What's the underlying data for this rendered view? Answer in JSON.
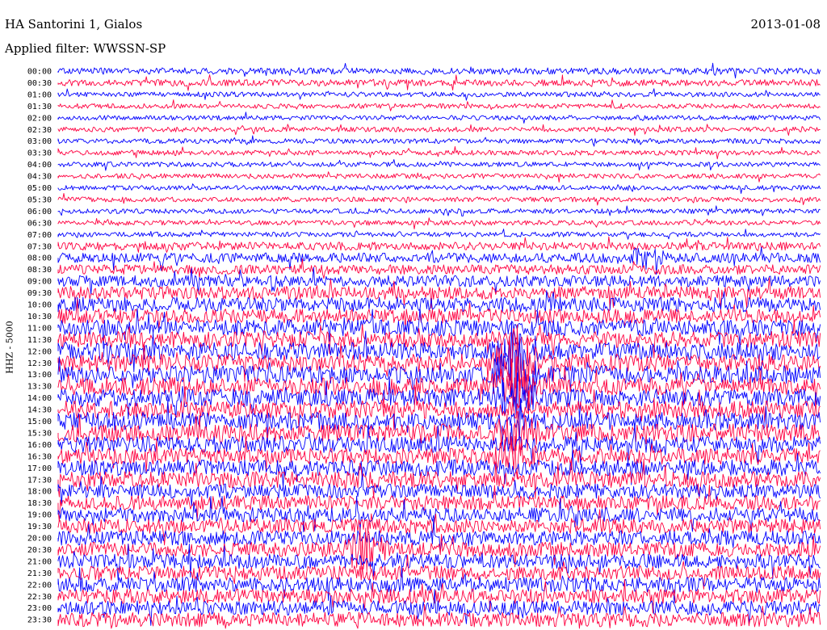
{
  "header": {
    "station": "HA Santorini 1, Gialos",
    "filter": "Applied filter: WWSSN-SP",
    "date": "2013-01-08"
  },
  "chart_data": {
    "type": "line",
    "title": "HA Santorini 1, Gialos",
    "subtitle": "Applied filter: WWSSN-SP",
    "date": "2013-01-08",
    "ylabel": "HHZ - 5000",
    "grid": false,
    "ytick_labels": [
      "00:00",
      "00:30",
      "01:00",
      "01:30",
      "02:00",
      "02:30",
      "03:00",
      "03:30",
      "04:00",
      "04:30",
      "05:00",
      "05:30",
      "06:00",
      "06:30",
      "07:00",
      "07:30",
      "08:00",
      "08:30",
      "09:00",
      "09:30",
      "10:00",
      "10:30",
      "11:00",
      "11:30",
      "12:00",
      "12:30",
      "13:00",
      "13:30",
      "14:00",
      "14:30",
      "15:00",
      "15:30",
      "16:00",
      "16:30",
      "17:00",
      "17:30",
      "18:00",
      "18:30",
      "19:00",
      "19:30",
      "20:00",
      "20:30",
      "21:00",
      "21:30",
      "22:00",
      "22:30",
      "23:00",
      "23:30"
    ],
    "trace_colors": [
      "#0000ff",
      "#ff0040"
    ],
    "trace_amplitude_profile": [
      4,
      4,
      3,
      3,
      3,
      3,
      3,
      3,
      3,
      3,
      3,
      3,
      3,
      3,
      3,
      5,
      6,
      6,
      7,
      8,
      9,
      9,
      10,
      10,
      11,
      11,
      11,
      11,
      11,
      11,
      11,
      11,
      10,
      10,
      10,
      10,
      9,
      9,
      9,
      9,
      9,
      9,
      9,
      9,
      9,
      9,
      9,
      9
    ],
    "events": [
      {
        "row": 24,
        "position": 0.6,
        "intensity": 3
      },
      {
        "row": 25,
        "position": 0.6,
        "intensity": 4
      },
      {
        "row": 26,
        "position": 0.6,
        "intensity": 4
      },
      {
        "row": 27,
        "position": 0.6,
        "intensity": 3
      },
      {
        "row": 28,
        "position": 0.6,
        "intensity": 2
      },
      {
        "row": 31,
        "position": 0.6,
        "intensity": 2
      },
      {
        "row": 33,
        "position": 0.6,
        "intensity": 2
      },
      {
        "row": 41,
        "position": 0.4,
        "intensity": 2.5
      },
      {
        "row": 16,
        "position": 0.77,
        "intensity": 1.5
      }
    ]
  }
}
